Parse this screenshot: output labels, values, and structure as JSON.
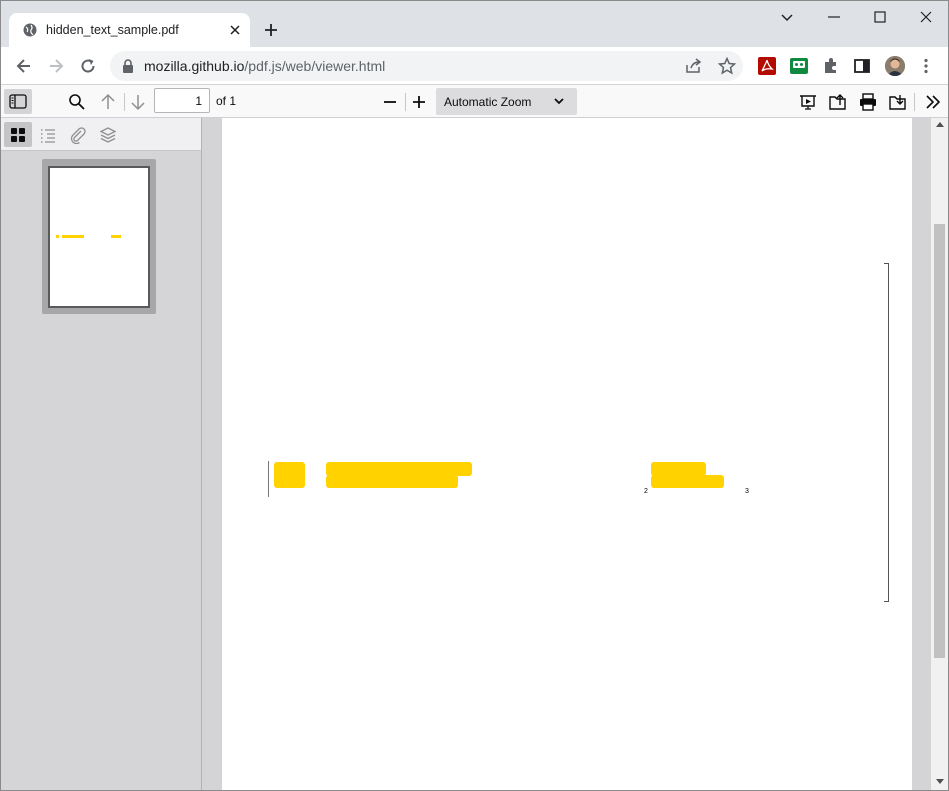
{
  "browser": {
    "tab": {
      "title": "hidden_text_sample.pdf"
    },
    "omnibox": {
      "url_domain": "mozilla.github.io",
      "url_path": "/pdf.js/web/viewer.html"
    },
    "icons": [
      "globe-icon",
      "close-icon",
      "plus-icon",
      "minimize-icon",
      "maximize-icon",
      "window-close-icon",
      "back-icon",
      "forward-icon",
      "reload-icon",
      "lock-icon",
      "share-icon",
      "star-icon",
      "acrobat-icon",
      "extension-icon",
      "puzzle-icon",
      "sidepanel-icon",
      "avatar",
      "kebab-menu-icon"
    ]
  },
  "pdf_toolbar": {
    "page_number": "1",
    "page_count_label": "of 1",
    "zoom_label": "Automatic Zoom",
    "icons": [
      "sidebar-toggle-icon",
      "search-icon",
      "previous-page-icon",
      "next-page-icon",
      "zoom-out-icon",
      "zoom-in-icon",
      "presentation-mode-icon",
      "open-file-icon",
      "print-icon",
      "save-icon",
      "tools-icon"
    ]
  },
  "sidebar": {
    "views": [
      "thumbnails-icon",
      "outline-icon",
      "attachments-icon",
      "layers-icon"
    ]
  },
  "document": {
    "superscript_left": "2",
    "superscript_right": "3"
  },
  "colors": {
    "highlight": "#ffd200",
    "tab_strip": "#dee1e6",
    "pdf_toolbar": "#f9f9fa",
    "sidebar": "#d5d5d8"
  }
}
